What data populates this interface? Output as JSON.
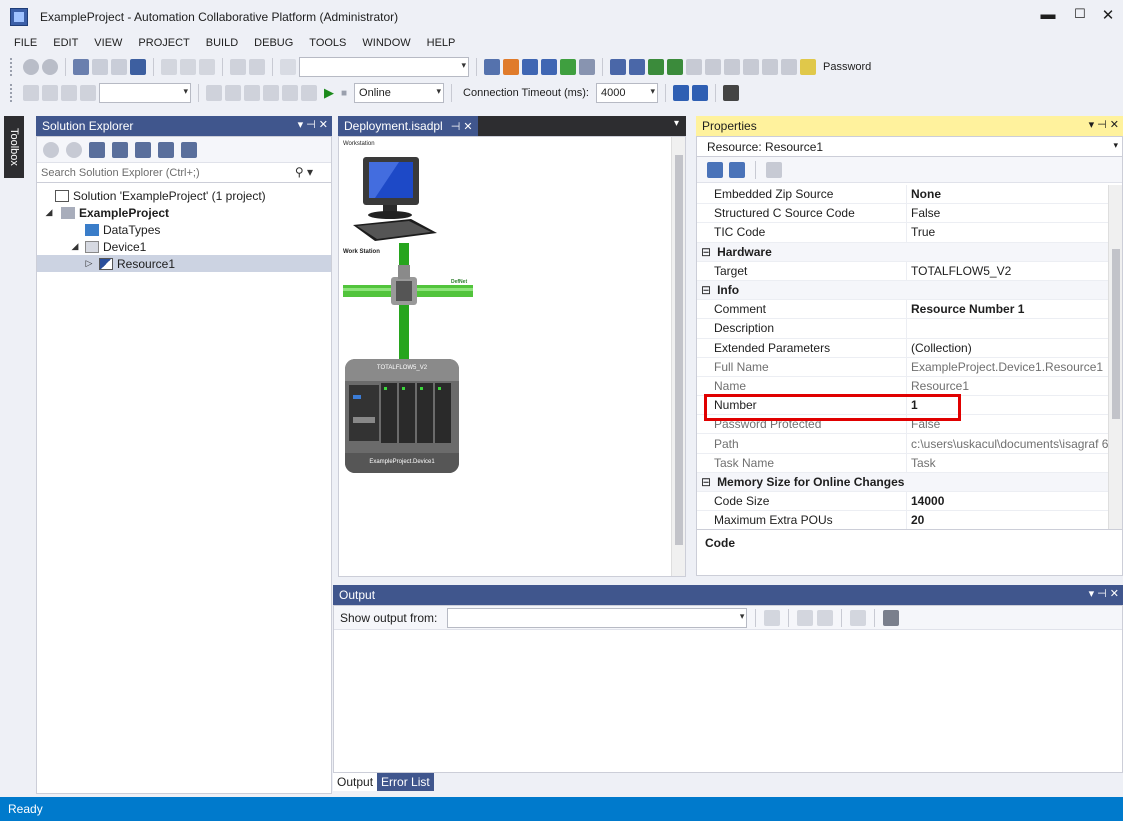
{
  "window": {
    "title": "ExampleProject - Automation Collaborative Platform (Administrator)",
    "controls": [
      "minimize",
      "maximize",
      "close"
    ]
  },
  "menu": [
    "FILE",
    "EDIT",
    "VIEW",
    "PROJECT",
    "BUILD",
    "DEBUG",
    "TOOLS",
    "WINDOW",
    "HELP"
  ],
  "toolbar": {
    "password_label": "Password",
    "online_select": "Online",
    "connection_timeout_label": "Connection Timeout (ms):",
    "connection_timeout_value": "4000"
  },
  "toolbox": {
    "label": "Toolbox"
  },
  "solution_explorer": {
    "title": "Solution Explorer",
    "search_placeholder": "Search Solution Explorer (Ctrl+;)",
    "tree": [
      {
        "label": "Solution 'ExampleProject' (1 project)",
        "level": 0,
        "expander": ""
      },
      {
        "label": "ExampleProject",
        "level": 0,
        "expander": "◢",
        "bold": true
      },
      {
        "label": "DataTypes",
        "level": 1,
        "expander": ""
      },
      {
        "label": "Device1",
        "level": 1,
        "expander": "◢"
      },
      {
        "label": "Resource1",
        "level": 2,
        "expander": "▷",
        "selected": true
      }
    ]
  },
  "deployment": {
    "tab_title": "Deployment.isadpl",
    "workstation_label": "Workstation",
    "network_station_label": "Work Station",
    "network_label": "DefNet",
    "device_model": "TOTALFLOW5_V2",
    "device_name": "ExampleProject.Device1"
  },
  "properties": {
    "title": "Properties",
    "object": "Resource: Resource1",
    "rows": [
      {
        "name": "Embedded Zip Source",
        "value": "None",
        "bold_value": true
      },
      {
        "name": "Structured C Source Code",
        "value": "False"
      },
      {
        "name": "TIC Code",
        "value": "True"
      },
      {
        "category": "Hardware"
      },
      {
        "name": "Target",
        "value": "TOTALFLOW5_V2"
      },
      {
        "category": "Info"
      },
      {
        "name": "Comment",
        "value": "Resource Number 1",
        "bold_value": true
      },
      {
        "name": "Description",
        "value": ""
      },
      {
        "name": "Extended Parameters",
        "value": "(Collection)"
      },
      {
        "name": "Full Name",
        "value": "ExampleProject.Device1.Resource1",
        "readonly": true
      },
      {
        "name": "Name",
        "value": "Resource1",
        "readonly": true
      },
      {
        "name": "Number",
        "value": "1",
        "bold_value": true
      },
      {
        "name": "Password Protected",
        "value": "False",
        "readonly": true
      },
      {
        "name": "Path",
        "value": "c:\\users\\uskacul\\documents\\isagraf 6",
        "readonly": true
      },
      {
        "name": "Task Name",
        "value": "Task",
        "readonly": true
      },
      {
        "category": "Memory Size for Online Changes"
      },
      {
        "name": "Code Size",
        "value": "14000",
        "bold_value": true
      },
      {
        "name": "Maximum Extra POUs",
        "value": "20",
        "bold_value": true
      }
    ],
    "description_title": "Code"
  },
  "output": {
    "title": "Output",
    "show_from_label": "Show output from:",
    "show_from_value": "",
    "tabs": [
      "Output",
      "Error List"
    ]
  },
  "status": {
    "text": "Ready"
  }
}
